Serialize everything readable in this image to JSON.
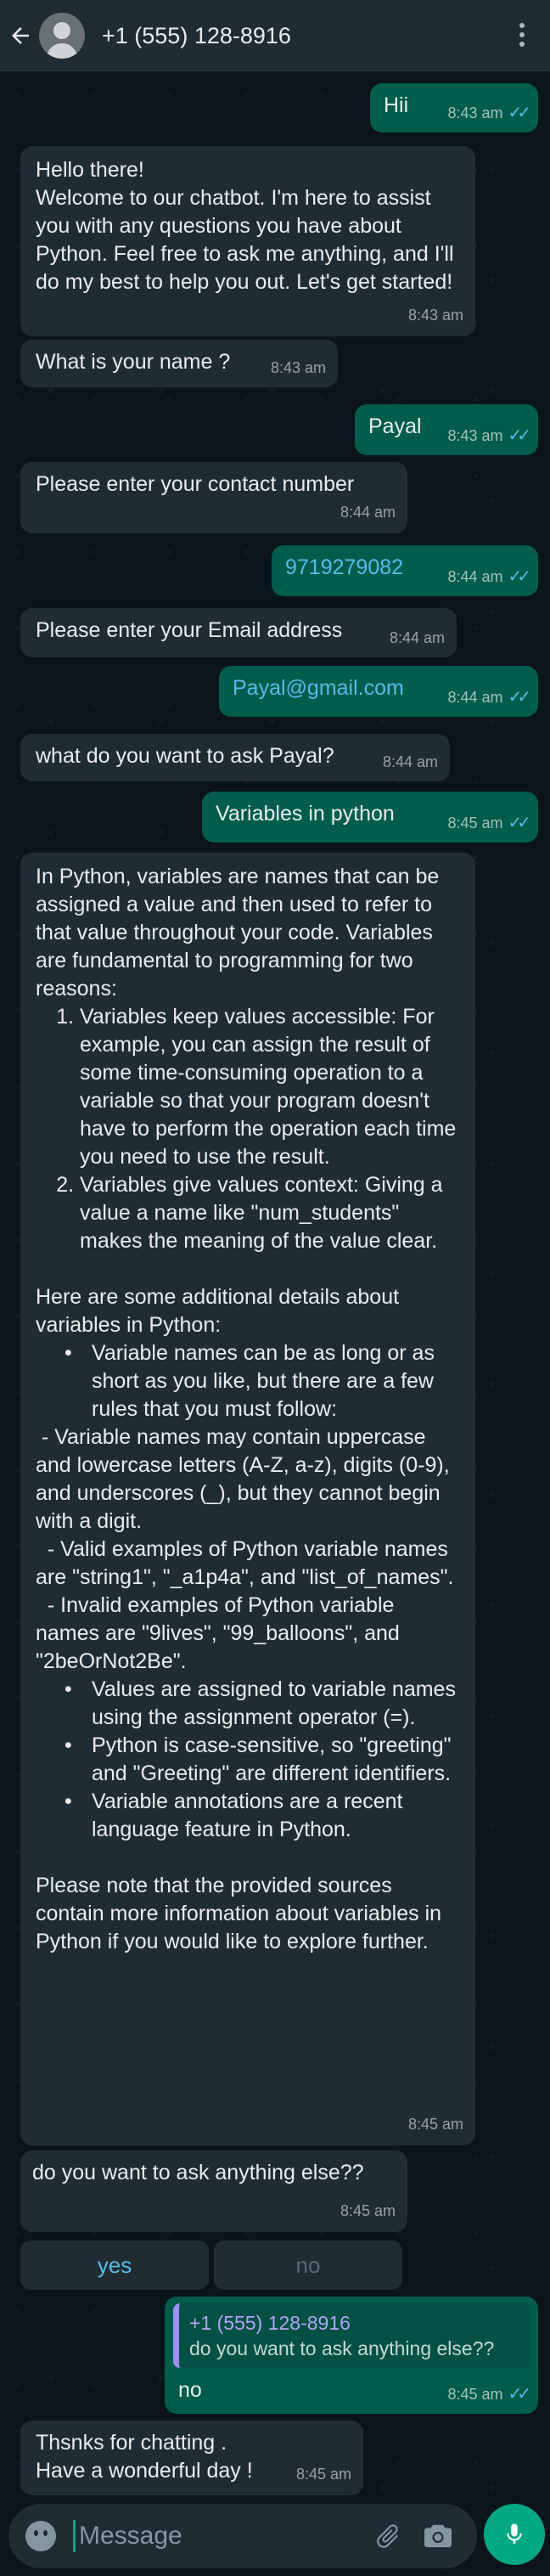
{
  "header": {
    "contact": "+1 (555) 128-8916"
  },
  "messages": [
    {
      "text": "Hii",
      "time": "8:43 am"
    },
    {
      "text": "Hello there!\nWelcome to our chatbot. I'm here to assist you with any questions you have about Python. Feel free to ask me anything, and I'll do my best to help you out. Let's get started!",
      "time": "8:43 am"
    },
    {
      "text": "What is your name ?",
      "time": "8:43 am"
    },
    {
      "text": "Payal",
      "time": "8:43 am"
    },
    {
      "text": "Please enter your contact number",
      "time": "8:44 am"
    },
    {
      "text": "9719279082",
      "time": "8:44 am"
    },
    {
      "text": "Please enter your Email address",
      "time": "8:44 am"
    },
    {
      "text": "Payal@gmail.com",
      "time": "8:44 am"
    },
    {
      "text": "what do you want to ask Payal?",
      "time": "8:44 am"
    },
    {
      "text": "Variables in python",
      "time": "8:45 am"
    },
    {
      "intro": "In Python, variables are names that can be assigned a value and then used to refer to that value throughout your code. Variables are fundamental to programming for two reasons:",
      "numbered": [
        "Variables keep values accessible: For example, you can assign the result of some time-consuming operation to a variable so that your program doesn't have to perform the operation each time you need to use the result.",
        "Variables give values context: Giving a value a name like \"num_students\" makes the meaning of the value clear."
      ],
      "details_intro": "Here are some additional details about variables in Python:",
      "bullet1": "Variable names can be as long or as short as you like, but there are a few rules that you must follow:",
      "sub_rules": [
        " - Variable names may contain uppercase and lowercase letters (A-Z, a-z), digits (0-9), and underscores (_), but they cannot begin with a digit.",
        "  - Valid examples of Python variable names are \"string1\", \"_a1p4a\", and \"list_of_names\".",
        "  - Invalid examples of Python variable names are \"9lives\", \"99_balloons\", and \"2beOrNot2Be\"."
      ],
      "bullets": [
        "Values are assigned to variable names using the assignment operator (=).",
        "Python is case-sensitive, so \"greeting\" and \"Greeting\" are different identifiers.",
        "Variable annotations are a recent language feature in Python."
      ],
      "closing": "Please note that the provided sources contain more information about variables in Python if you would like to explore further.",
      "time": "8:45 am"
    },
    {
      "text": "do you want to ask anything else??",
      "time": "8:45 am"
    },
    {
      "quote_name": "+1 (555) 128-8916",
      "quote_text": "do you want to ask anything else??",
      "text": "no",
      "time": "8:45 am"
    },
    {
      "text": "Thsnks for chatting .\nHave a wonderful day !",
      "time": "8:45 am"
    }
  ],
  "quick_replies": [
    "yes",
    "no"
  ],
  "input": {
    "placeholder": "Message"
  },
  "icons": [
    "back-arrow-icon",
    "avatar-icon",
    "more-vert-icon",
    "read-ticks-icon",
    "emoji-icon",
    "attach-icon",
    "camera-icon",
    "mic-icon"
  ],
  "colors": {
    "incoming": "#202c33",
    "outgoing": "#005c4b",
    "accent": "#00a884",
    "ticks": "#53bdeb"
  }
}
